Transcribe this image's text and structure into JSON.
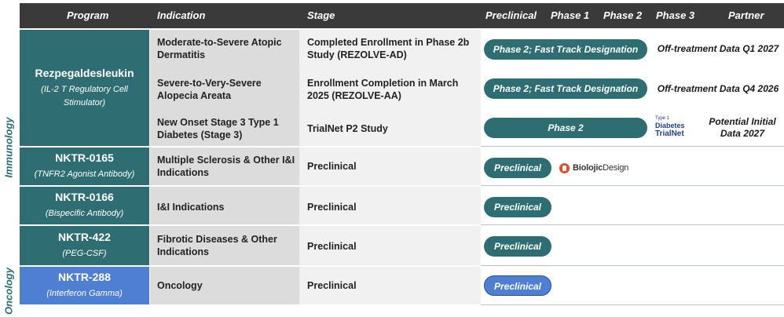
{
  "header": {
    "program": "Program",
    "indication": "Indication",
    "stage": "Stage",
    "preclinical": "Preclinical",
    "phase1": "Phase 1",
    "phase2": "Phase 2",
    "phase3": "Phase 3",
    "partner": "Partner"
  },
  "side_labels": {
    "immunology": "Immunology",
    "oncology": "Oncology"
  },
  "programs": [
    {
      "name": "Rezpegaldesleukin",
      "sub": "(IL-2 T Regulatory Cell Stimulator)"
    },
    {
      "name": "NKTR-0165",
      "sub": "(TNFR2 Agonist Antibody)"
    },
    {
      "name": "NKTR-0166",
      "sub": "(Bispecific Antibody)"
    },
    {
      "name": "NKTR-422",
      "sub": "(PEG-CSF)"
    },
    {
      "name": "NKTR-288",
      "sub": "(Interferon Gamma)"
    }
  ],
  "rows": [
    {
      "indication": "Moderate-to-Severe Atopic Dermatitis",
      "stage": "Completed Enrollment in Phase 2b Study (REZOLVE-AD)",
      "pill": "Phase 2; Fast Track Designation",
      "partner": "Off-treatment Data Q1 2027"
    },
    {
      "indication": "Severe-to-Very-Severe Alopecia Areata",
      "stage": "Enrollment Completion in March 2025 (REZOLVE-AA)",
      "pill": "Phase 2; Fast Track Designation",
      "partner": "Off-treatment Data Q4 2026"
    },
    {
      "indication": "New Onset Stage 3 Type 1 Diabetes (Stage 3)",
      "stage": "TrialNet P2 Study",
      "pill": "Phase 2",
      "partner": "Potential Initial Data 2027"
    },
    {
      "indication": "Multiple Sclerosis & Other I&I Indications",
      "stage": "Preclinical",
      "pill": "Preclinical",
      "partner": ""
    },
    {
      "indication": "I&I Indications",
      "stage": "Preclinical",
      "pill": "Preclinical",
      "partner": ""
    },
    {
      "indication": "Fibrotic Diseases & Other Indications",
      "stage": "Preclinical",
      "pill": "Preclinical",
      "partner": ""
    },
    {
      "indication": "Oncology",
      "stage": "Preclinical",
      "pill": "Preclinical",
      "partner": ""
    }
  ],
  "logos": {
    "biolojic": {
      "bold": "Biolojic",
      "rest": "Design"
    },
    "trialnet": {
      "line1": "Type 1",
      "line2": "Diabetes",
      "line3": "TrialNet"
    }
  },
  "colors": {
    "teal": "#2e6e72",
    "blue": "#4e7fd2",
    "header": "#3a3a3a"
  }
}
